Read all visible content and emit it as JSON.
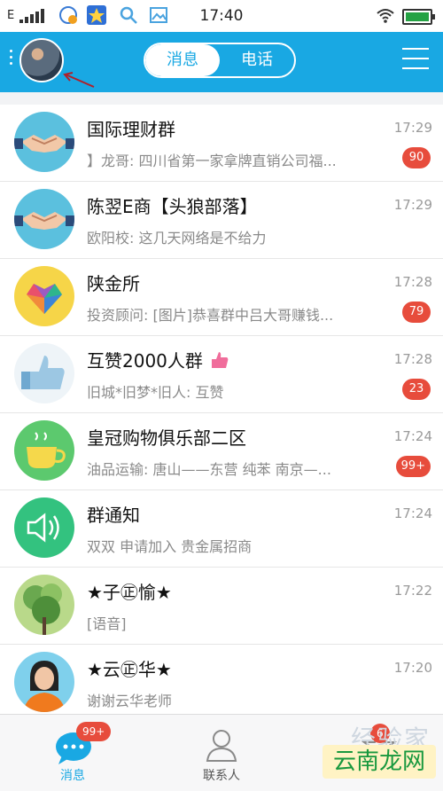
{
  "status": {
    "carrier": "E",
    "time": "17:40"
  },
  "header": {
    "tab_messages": "消息",
    "tab_calls": "电话"
  },
  "chats": [
    {
      "title": "国际理财群",
      "preview": "】龙哥: 四川省第一家拿牌直销公司福...",
      "time": "17:29",
      "badge": "90",
      "avatar": "handshake-icon"
    },
    {
      "title": "陈翌E商【头狼部落】",
      "preview": "欧阳校: 这几天网络是不给力",
      "time": "17:29",
      "badge": "",
      "avatar": "handshake-icon"
    },
    {
      "title": "陕金所",
      "preview": "投资顾问: [图片]恭喜群中吕大哥赚钱...",
      "time": "17:28",
      "badge": "79",
      "avatar": "heart-mosaic-icon"
    },
    {
      "title": "互赞2000人群",
      "preview": "旧城*旧梦*旧人: 互赞",
      "time": "17:28",
      "badge": "23",
      "avatar": "thumbs-up-wordcloud-icon"
    },
    {
      "title": "皇冠购物俱乐部二区",
      "preview": "油品运输: 唐山——东营  纯苯 南京—...",
      "time": "17:24",
      "badge": "99+",
      "avatar": "coffee-cup-icon"
    },
    {
      "title": "群通知",
      "preview": "双双 申请加入 贵金属招商",
      "time": "17:24",
      "badge": "",
      "avatar": "speaker-icon"
    },
    {
      "title": "★子㊣愉★",
      "preview": "[语音]",
      "time": "17:22",
      "badge": "",
      "avatar": "plant-photo"
    },
    {
      "title": "★云㊣华★",
      "preview": "谢谢云华老师",
      "time": "17:20",
      "badge": "",
      "avatar": "person-photo"
    }
  ],
  "tabbar": {
    "messages_label": "消息",
    "messages_badge": "99+",
    "contacts_label": "联系人",
    "dynamic_badge": "6"
  },
  "watermark": {
    "text": "云南龙网",
    "faint": "经验家"
  },
  "colors": {
    "accent": "#19a8e3",
    "badge": "#e74c3c"
  }
}
